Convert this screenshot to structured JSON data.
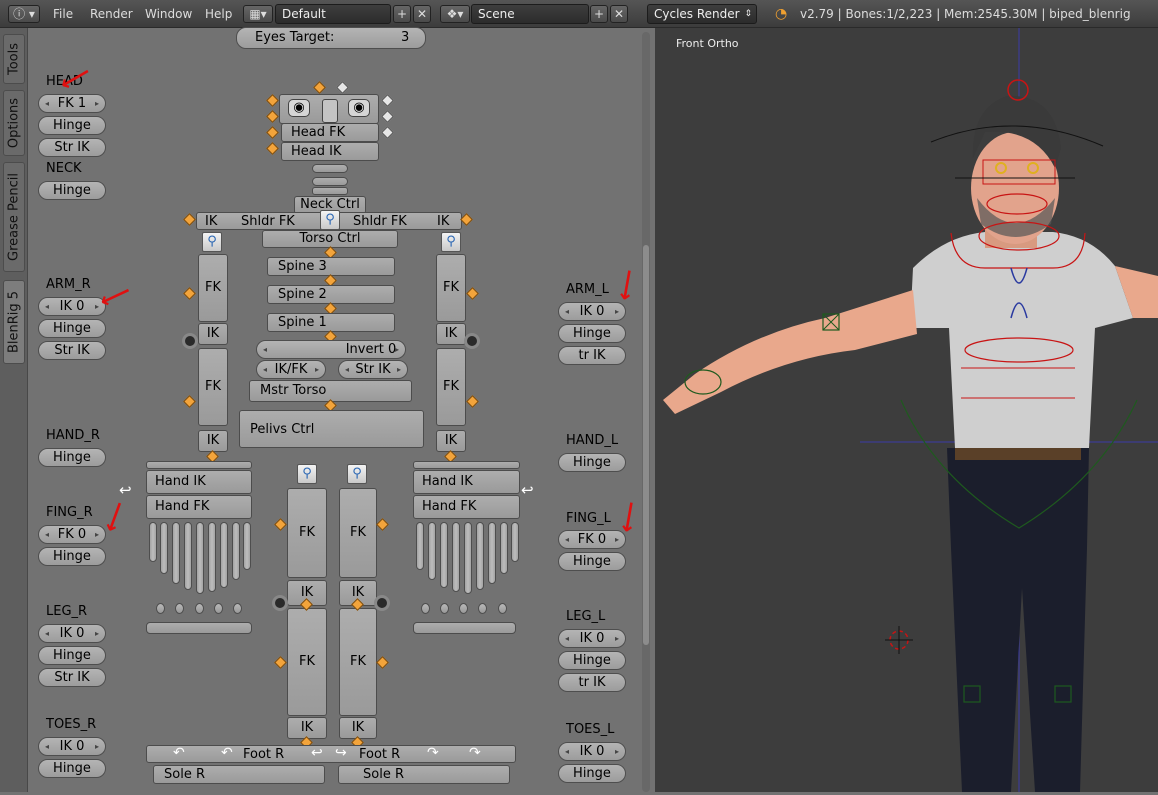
{
  "topbar": {
    "menu": [
      "File",
      "Render",
      "Window",
      "Help"
    ],
    "layout_name": "Default",
    "scene_name": "Scene",
    "render_engine": "Cycles Render",
    "stats": "v2.79 | Bones:1/2,223 | Mem:2545.30M | biped_blenrig"
  },
  "sidetabs": [
    "Tools",
    "Options",
    "Grease Pencil",
    "BlenRig 5"
  ],
  "panel": {
    "eyes_target_label": "Eyes Target:",
    "eyes_target_value": "3",
    "left": {
      "head": {
        "label": "HEAD",
        "b1": "FK 1",
        "b2": "Hinge",
        "b3": "Str IK"
      },
      "neck": {
        "label": "NECK",
        "b1": "Hinge"
      },
      "arm": {
        "label": "ARM_R",
        "b1": "IK 0",
        "b2": "Hinge",
        "b3": "Str IK"
      },
      "hand": {
        "label": "HAND_R",
        "b1": "Hinge"
      },
      "fing": {
        "label": "FING_R",
        "b1": "FK 0",
        "b2": "Hinge"
      },
      "leg": {
        "label": "LEG_R",
        "b1": "IK 0",
        "b2": "Hinge",
        "b3": "Str IK"
      },
      "toes": {
        "label": "TOES_R",
        "b1": "IK 0",
        "b2": "Hinge"
      }
    },
    "right": {
      "arm": {
        "label": "ARM_L",
        "b1": "IK 0",
        "b2": "Hinge",
        "b3": "tr IK"
      },
      "hand": {
        "label": "HAND_L",
        "b1": "Hinge"
      },
      "fing": {
        "label": "FING_L",
        "b1": "FK 0",
        "b2": "Hinge"
      },
      "leg": {
        "label": "LEG_L",
        "b1": "IK 0",
        "b2": "Hinge",
        "b3": "tr IK"
      },
      "toes": {
        "label": "TOES_L",
        "b1": "IK 0",
        "b2": "Hinge"
      }
    },
    "body": {
      "head_fk": "Head FK",
      "head_ik": "Head IK",
      "neck_ctrl": "Neck Ctrl",
      "ik": "IK",
      "shldr_fk": "Shldr FK",
      "torso_ctrl": "Torso Ctrl",
      "spine3": "Spine 3",
      "spine2": "Spine 2",
      "spine1": "Spine 1",
      "fk": "FK",
      "invert": "Invert 0",
      "ikfk": "IK/FK",
      "str_ik": "Str IK",
      "mstr_torso": "Mstr Torso",
      "pelvis_ctrl": "Pelivs Ctrl",
      "hand_ik": "Hand IK",
      "hand_fk": "Hand FK",
      "foot_r": "Foot R",
      "sole_r": "Sole R"
    }
  },
  "viewport": {
    "title": "Front Ortho"
  },
  "colors": {
    "accent_orange": "#f3a43b",
    "annotation_red": "#e01010",
    "rig_red": "#c81414"
  }
}
